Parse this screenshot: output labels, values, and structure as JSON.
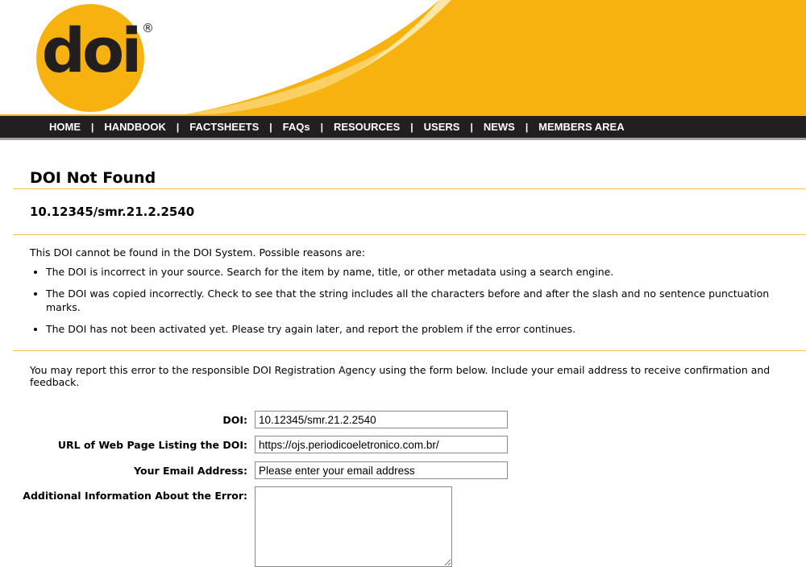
{
  "header": {
    "logo_text": "doi",
    "registered_mark": "®"
  },
  "nav": {
    "items": [
      "HOME",
      "HANDBOOK",
      "FACTSHEETS",
      "FAQs",
      "RESOURCES",
      "USERS",
      "NEWS",
      "MEMBERS AREA"
    ],
    "separator": "|"
  },
  "page": {
    "title": "DOI Not Found",
    "doi": "10.12345/smr.21.2.2540",
    "intro": "This DOI cannot be found in the DOI System. Possible reasons are:",
    "reasons": [
      "The DOI is incorrect in your source. Search for the item by name, title, or other metadata using a search engine.",
      "The DOI was copied incorrectly. Check to see that the string includes all the characters before and after the slash and no sentence punctuation marks.",
      "The DOI has not been activated yet. Please try again later, and report the problem if the error continues."
    ],
    "report_text": "You may report this error to the responsible DOI Registration Agency using the form below. Include your email address to receive confirmation and feedback."
  },
  "form": {
    "doi_label": "DOI:",
    "doi_value": "10.12345/smr.21.2.2540",
    "url_label": "URL of Web Page Listing the DOI:",
    "url_value": "https://ojs.periodicoeletronico.com.br/",
    "email_label": "Your Email Address:",
    "email_value": "Please enter your email address",
    "info_label": "Additional Information About the Error:",
    "info_value": ""
  },
  "colors": {
    "brand_yellow": "#f7b20f",
    "nav_bg": "#231f20",
    "divider": "#f3c04b"
  }
}
